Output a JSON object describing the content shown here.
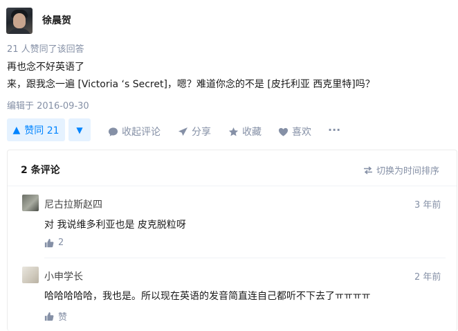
{
  "answer": {
    "author_name": "徐晨贺",
    "votes_meta": "21 人赞同了该回答",
    "content_lines": [
      "再也念不好英语了",
      "来，跟我念一遍 [Victoria ‘s Secret]，嗯？难道你念的不是 [皮托利亚 西克里特]吗？"
    ],
    "edited": "编辑于 2016-09-30"
  },
  "actions": {
    "vote_up_label": "赞同 21",
    "collapse_comments": "收起评论",
    "share": "分享",
    "favorite": "收藏",
    "like": "喜欢",
    "more": "···"
  },
  "comments": {
    "count_label": "2 条评论",
    "sort_toggle": "切换为时间排序",
    "items": [
      {
        "author": "尼古拉斯赵四",
        "time": "3 年前",
        "text": "对 我说维多利亚也是 皮克脱粒呀",
        "likes": "2"
      },
      {
        "author": "小申学长",
        "time": "2 年前",
        "text": "哈哈哈哈哈，我也是。所以现在英语的发音简直连自己都听不下去了ㅠㅠㅠㅠ",
        "likes": "赞"
      }
    ]
  },
  "colors": {
    "accent": "#0084ff",
    "accent_bg": "#e5f2ff",
    "muted": "#8590a6",
    "text": "#1a1a1a"
  }
}
